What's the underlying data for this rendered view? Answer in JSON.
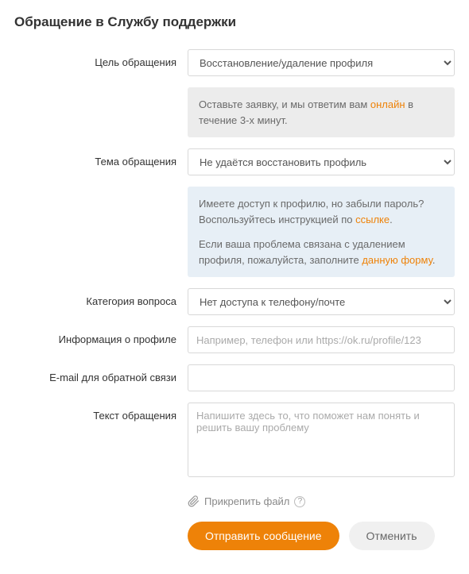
{
  "title": "Обращение в Службу поддержки",
  "form": {
    "purpose": {
      "label": "Цель обращения",
      "value": "Восстановление/удаление профиля"
    },
    "purpose_info": {
      "text_before": "Оставьте заявку, и мы ответим вам ",
      "link": "онлайн",
      "text_after": " в течение 3-х минут."
    },
    "subject": {
      "label": "Тема обращения",
      "value": "Не удаётся восстановить профиль"
    },
    "subject_info": {
      "p1_before": "Имеете доступ к профилю, но забыли пароль? Воспользуйтесь инструкцией по ",
      "p1_link": "ссылке",
      "p1_after": ".",
      "p2_before": "Если ваша проблема связана с удалением профиля, пожалуйста, заполните ",
      "p2_link": "данную форму",
      "p2_after": "."
    },
    "category": {
      "label": "Категория вопроса",
      "value": "Нет доступа к телефону/почте"
    },
    "profile_info": {
      "label": "Информация о профиле",
      "placeholder": "Например, телефон или https://ok.ru/profile/123"
    },
    "email": {
      "label": "E-mail для обратной связи"
    },
    "message": {
      "label": "Текст обращения",
      "placeholder": "Напишите здесь то, что поможет нам понять и решить вашу проблему"
    },
    "attach": {
      "label": "Прикрепить файл"
    },
    "submit": "Отправить сообщение",
    "cancel": "Отменить"
  }
}
